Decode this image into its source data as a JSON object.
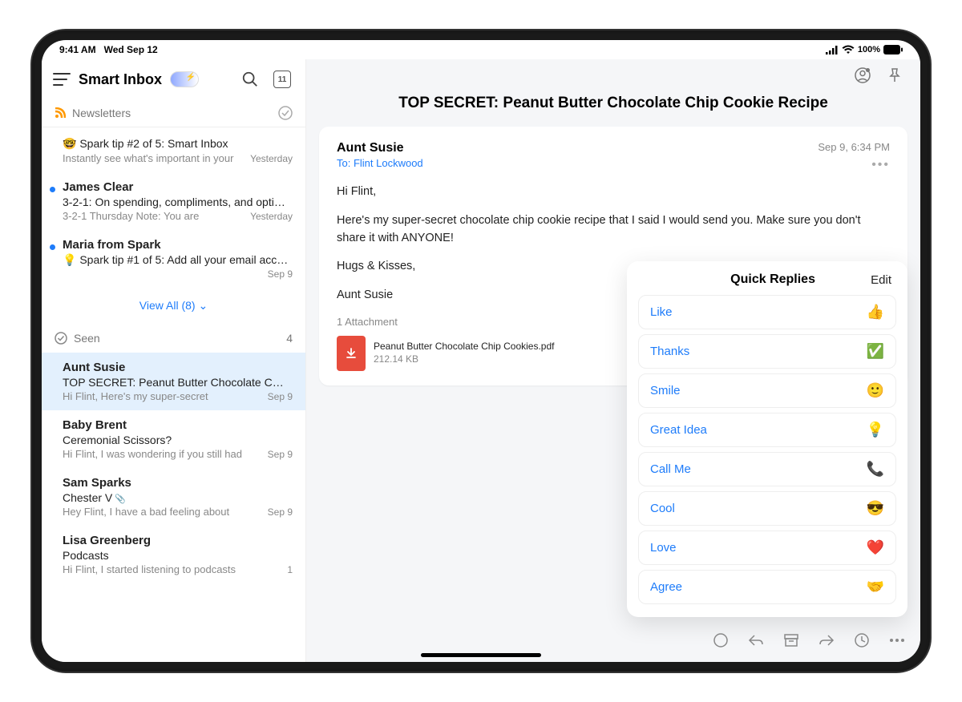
{
  "status": {
    "time": "9:41 AM",
    "date": "Wed Sep 12",
    "battery": "100%"
  },
  "sidebar": {
    "title": "Smart Inbox",
    "calendar_date": "11",
    "sections": {
      "newsletters": "Newsletters",
      "seen": "Seen",
      "seen_count": "4"
    },
    "view_all": "View All (8)",
    "newsletters_items": [
      {
        "emoji": "🤓",
        "sender": "",
        "subject": "Spark tip #2 of 5: Smart Inbox",
        "preview": "Instantly see what's important in your",
        "date": "Yesterday",
        "unread": false
      },
      {
        "sender": "James Clear",
        "subject": "3-2-1: On spending, compliments, and opti…",
        "preview": "3-2-1 Thursday Note: You are",
        "date": "Yesterday",
        "unread": true
      },
      {
        "emoji": "💡",
        "sender": "Maria from Spark",
        "subject": "Spark tip #1 of 5: Add all your email acco…",
        "preview": "",
        "date": "Sep 9",
        "unread": true
      }
    ],
    "seen_items": [
      {
        "sender": "Aunt Susie",
        "subject": "TOP SECRET: Peanut Butter Chocolate C…",
        "preview": "Hi Flint, Here's my super-secret",
        "date": "Sep 9",
        "selected": true,
        "has_attach": true
      },
      {
        "sender": "Baby Brent",
        "subject": "Ceremonial Scissors?",
        "preview": "Hi Flint, I was wondering if you still had",
        "date": "Sep 9"
      },
      {
        "sender": "Sam Sparks",
        "subject": "Chester V",
        "preview": "Hey Flint, I have a bad feeling about",
        "date": "Sep 9",
        "has_attach": true
      },
      {
        "sender": "Lisa Greenberg",
        "subject": "Podcasts",
        "preview": "Hi Flint, I started listening to podcasts",
        "date": "1"
      }
    ]
  },
  "email": {
    "title": "TOP SECRET: Peanut Butter Chocolate Chip Cookie Recipe",
    "from": "Aunt Susie",
    "to_label": "To: Flint Lockwood",
    "date": "Sep 9, 6:34 PM",
    "body": {
      "p1": "Hi Flint,",
      "p2": "Here's my super-secret chocolate chip cookie recipe that I said I would send you. Make sure you don't share it with ANYONE!",
      "p3": "Hugs & Kisses,",
      "p4": "Aunt Susie"
    },
    "attachment_count": "1 Attachment",
    "attachment": {
      "name": "Peanut Butter Chocolate Chip Cookies.pdf",
      "size": "212.14 KB"
    }
  },
  "quick_replies": {
    "title": "Quick Replies",
    "edit": "Edit",
    "items": [
      {
        "label": "Like",
        "emoji": "👍"
      },
      {
        "label": "Thanks",
        "emoji": "✅"
      },
      {
        "label": "Smile",
        "emoji": "🙂"
      },
      {
        "label": "Great Idea",
        "emoji": "💡"
      },
      {
        "label": "Call Me",
        "emoji": "📞"
      },
      {
        "label": "Cool",
        "emoji": "😎"
      },
      {
        "label": "Love",
        "emoji": "❤️"
      },
      {
        "label": "Agree",
        "emoji": "🤝"
      }
    ]
  }
}
